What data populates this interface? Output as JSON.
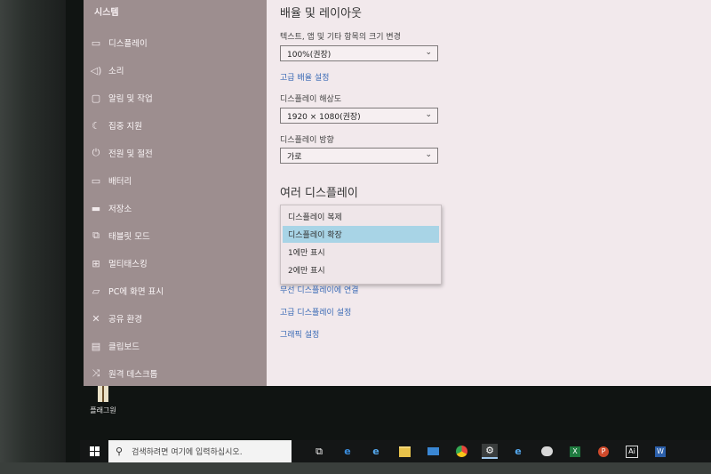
{
  "sidebar": {
    "title": "시스템",
    "items": [
      {
        "label": "디스플레이",
        "icon": "monitor-icon"
      },
      {
        "label": "소리",
        "icon": "speaker-icon"
      },
      {
        "label": "알림 및 작업",
        "icon": "notification-icon"
      },
      {
        "label": "집중 지원",
        "icon": "moon-icon"
      },
      {
        "label": "전원 및 절전",
        "icon": "power-icon"
      },
      {
        "label": "배터리",
        "icon": "battery-icon"
      },
      {
        "label": "저장소",
        "icon": "storage-icon"
      },
      {
        "label": "태블릿 모드",
        "icon": "tablet-icon"
      },
      {
        "label": "멀티태스킹",
        "icon": "multitasking-icon"
      },
      {
        "label": "PC에 화면 표시",
        "icon": "project-icon"
      },
      {
        "label": "공유 환경",
        "icon": "share-icon"
      },
      {
        "label": "클립보드",
        "icon": "clipboard-icon"
      },
      {
        "label": "원격 데스크톱",
        "icon": "remote-desktop-icon"
      }
    ]
  },
  "main": {
    "scale_heading": "배율 및 레이아웃",
    "scale_label": "텍스트, 앱 및 기타 항목의 크기 변경",
    "scale_value": "100%(권장)",
    "advanced_scale_link": "고급 배율 설정",
    "resolution_label": "디스플레이 해상도",
    "resolution_value": "1920 × 1080(권장)",
    "orientation_label": "디스플레이 방향",
    "orientation_value": "가로",
    "multi_heading": "여러 디스플레이",
    "multi_options": [
      "디스플레이 복제",
      "디스플레이 확장",
      "1에만 표시",
      "2에만 표시"
    ],
    "multi_selected": "디스플레이 확장",
    "wireless_link": "무선 디스플레이에 연결",
    "advanced_display_link": "고급 디스플레이 설정",
    "graphics_link": "그래픽 설정"
  },
  "desktop": {
    "icon_label": "플래그원"
  },
  "taskbar": {
    "search_placeholder": "검색하려면 여기에 입력하십시오.",
    "apps": [
      "task-view-icon",
      "edge-icon",
      "ie-icon",
      "file-explorer-icon",
      "mail-icon",
      "chrome-icon",
      "settings-icon",
      "ie-icon",
      "paint-icon",
      "excel-icon",
      "powerpoint-icon",
      "illustrator-icon",
      "word-icon"
    ]
  },
  "colors": {
    "sidebar_bg": "#9d8e8f",
    "content_bg": "#f2e9ec",
    "selected_option": "#a8d4e6",
    "link": "#3a6ab5",
    "taskbar_bg": "#141616"
  }
}
